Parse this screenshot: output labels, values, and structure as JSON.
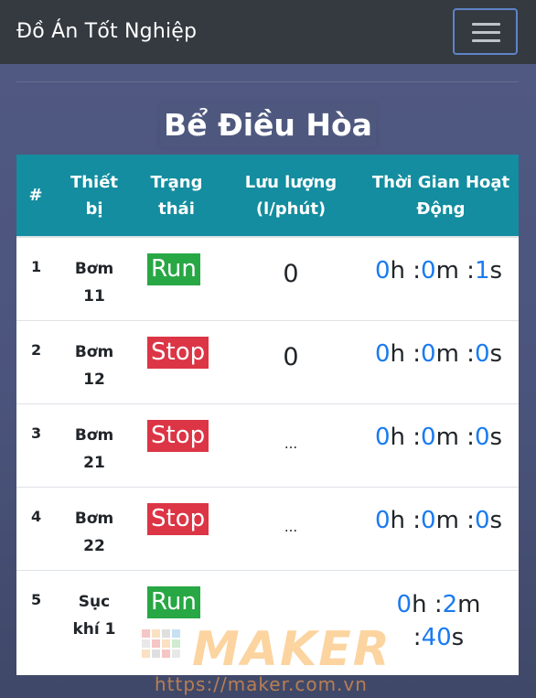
{
  "navbar": {
    "brand": "Đồ Án Tốt Nghiệp",
    "toggler_icon": "hamburger-menu-icon"
  },
  "page": {
    "title": "Bể Điều Hòa"
  },
  "table": {
    "headers": [
      "#",
      "Thiết bị",
      "Trạng thái",
      "Lưu lượng (l/phút)",
      "Thời Gian Hoạt Động"
    ],
    "rows": [
      {
        "num": "1",
        "device": "Bơm 11",
        "status": "Run",
        "flow": "0",
        "time": {
          "h": "0",
          "h_unit": "h :",
          "m": "0",
          "m_unit": "m :",
          "s": "1",
          "s_unit": "s"
        }
      },
      {
        "num": "2",
        "device": "Bơm 12",
        "status": "Stop",
        "flow": "0",
        "time": {
          "h": "0",
          "h_unit": "h :",
          "m": "0",
          "m_unit": "m :",
          "s": "0",
          "s_unit": "s"
        }
      },
      {
        "num": "3",
        "device": "Bơm 21",
        "status": "Stop",
        "flow": "...",
        "time": {
          "h": "0",
          "h_unit": "h :",
          "m": "0",
          "m_unit": "m :",
          "s": "0",
          "s_unit": "s"
        }
      },
      {
        "num": "4",
        "device": "Bơm 22",
        "status": "Stop",
        "flow": "...",
        "time": {
          "h": "0",
          "h_unit": "h :",
          "m": "0",
          "m_unit": "m :",
          "s": "0",
          "s_unit": "s"
        }
      },
      {
        "num": "5",
        "device": "Sục khí 1",
        "status": "Run",
        "flow": "",
        "time": {
          "h": "0",
          "h_unit": "h :",
          "m": "2",
          "m_unit": "m",
          "s_prefix": ":",
          "s": "40",
          "s_unit": "s"
        }
      }
    ]
  },
  "watermark": {
    "logo": "MAKER",
    "url": "https://maker.com.vn"
  },
  "colors": {
    "run": "#28a745",
    "stop": "#dc3545",
    "header": "#138d9f",
    "time_value": "#1a7bf0"
  }
}
